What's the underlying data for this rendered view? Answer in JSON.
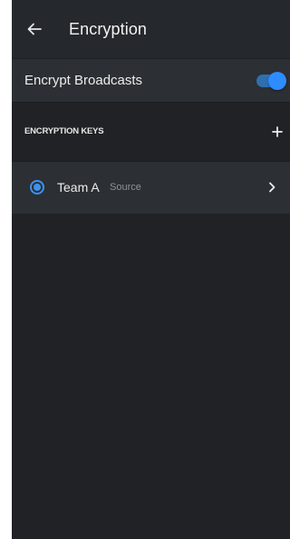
{
  "header": {
    "title": "Encryption",
    "back_icon": "arrow-left-icon"
  },
  "settings": {
    "encrypt_broadcasts": {
      "label": "Encrypt Broadcasts",
      "enabled": true
    }
  },
  "encryption_keys": {
    "section_title": "ENCRYPTION KEYS",
    "add_icon": "plus-icon",
    "items": [
      {
        "name": "Team A",
        "role": "Source",
        "selected": true
      }
    ]
  },
  "colors": {
    "background": "#202225",
    "surface": "#2c2f33",
    "accent": "#2d8cff",
    "secondary_text": "#8e9297"
  }
}
